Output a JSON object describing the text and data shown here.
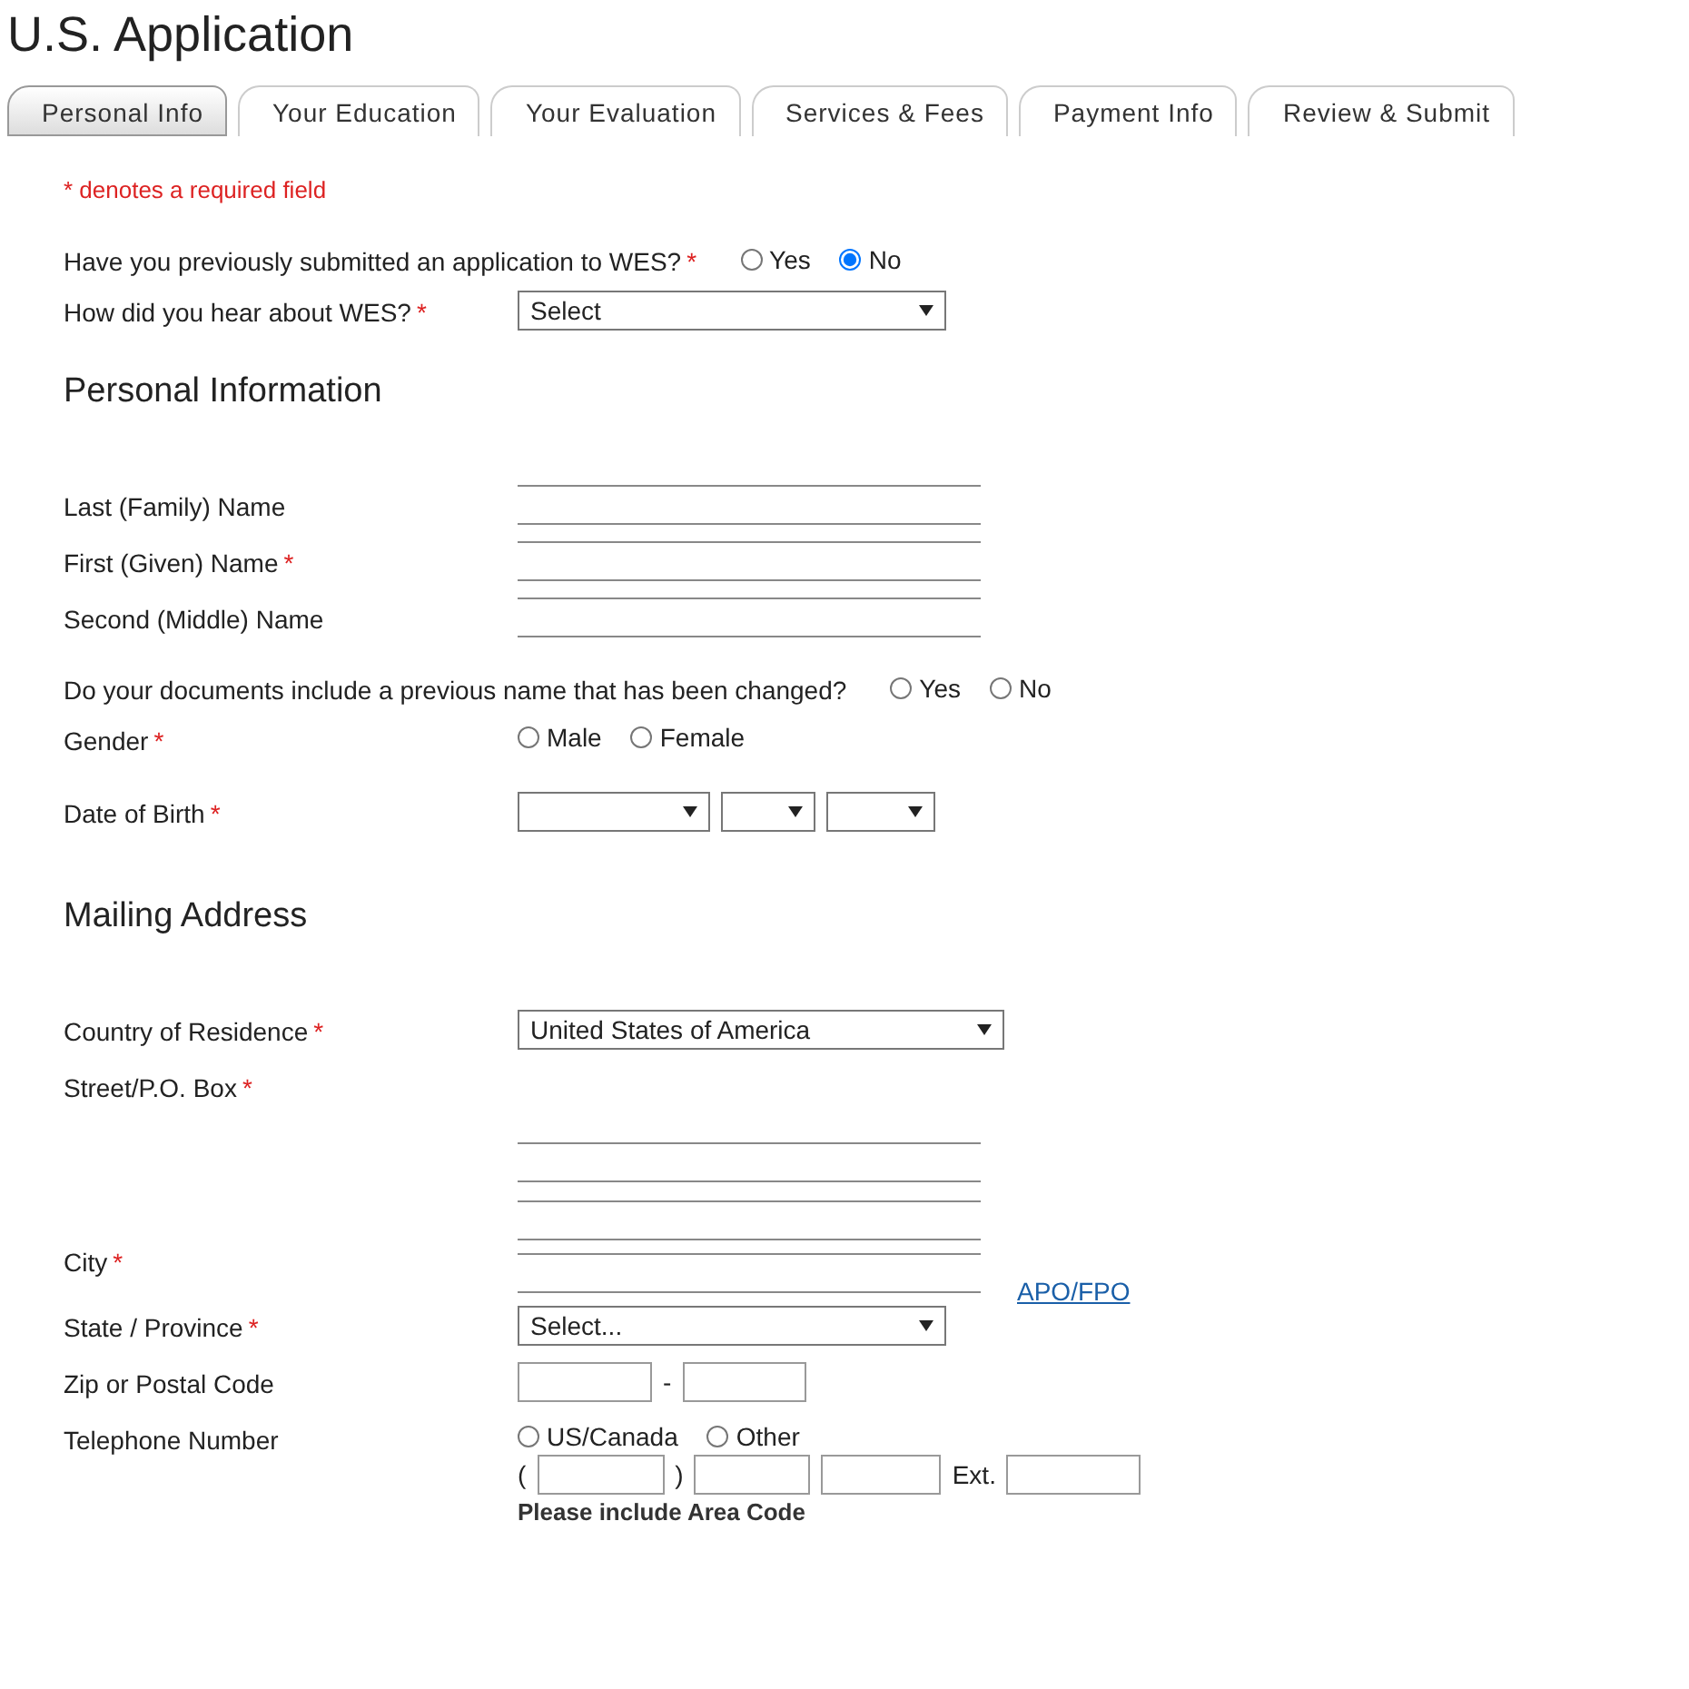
{
  "title": "U.S. Application",
  "tabs": [
    {
      "label": "Personal Info",
      "selected": true
    },
    {
      "label": "Your Education",
      "selected": false
    },
    {
      "label": "Your Evaluation",
      "selected": false
    },
    {
      "label": "Services & Fees",
      "selected": false
    },
    {
      "label": "Payment Info",
      "selected": false
    },
    {
      "label": "Review & Submit",
      "selected": false
    }
  ],
  "required_note": "* denotes a required field",
  "questions": [
    {
      "kind": "radio",
      "label": "Have you previously submitted an application to WES?",
      "required_mark": "*",
      "options": [
        {
          "label": "Yes",
          "selected": false
        },
        {
          "label": "No",
          "selected": true
        }
      ]
    },
    {
      "kind": "select",
      "label": "How did you hear about WES?",
      "required_mark": "*",
      "value": "Select"
    }
  ],
  "sections": [
    {
      "heading": "Personal Information",
      "fields": [
        {
          "kind": "text",
          "label": "Last (Family) Name"
        },
        {
          "kind": "text",
          "label": "First (Given) Name",
          "required_mark": "*"
        },
        {
          "kind": "text",
          "label": "Second (Middle) Name"
        },
        {
          "kind": "radio",
          "label": "Do your documents include a previous name that has been changed?",
          "options": [
            {
              "label": "Yes",
              "selected": false
            },
            {
              "label": "No",
              "selected": false
            }
          ]
        },
        {
          "kind": "radio",
          "label": "Gender",
          "required_mark": "*",
          "options": [
            {
              "label": "Male",
              "selected": false
            },
            {
              "label": "Female",
              "selected": false
            }
          ]
        },
        {
          "kind": "date",
          "label": "Date of Birth",
          "required_mark": "*"
        }
      ]
    },
    {
      "heading": "Mailing Address",
      "fields": [
        {
          "kind": "select",
          "label": "Country of Residence",
          "required_mark": "*",
          "value": "United States of America"
        },
        {
          "kind": "street",
          "label": "Street/P.O. Box",
          "required_mark": "*"
        },
        {
          "kind": "text",
          "label": "City",
          "required_mark": "*",
          "link": "APO/FPO"
        },
        {
          "kind": "select",
          "label": "State / Province",
          "required_mark": "*",
          "value": "Select..."
        },
        {
          "kind": "zip",
          "label": "Zip or Postal Code",
          "separator": "-"
        },
        {
          "kind": "phone",
          "label": "Telephone Number",
          "options": [
            {
              "label": "US/Canada",
              "selected": false
            },
            {
              "label": "Other",
              "selected": false
            }
          ],
          "open": "(",
          "close": ")",
          "ext": "Ext.",
          "hint": "Please include Area Code"
        }
      ]
    }
  ]
}
